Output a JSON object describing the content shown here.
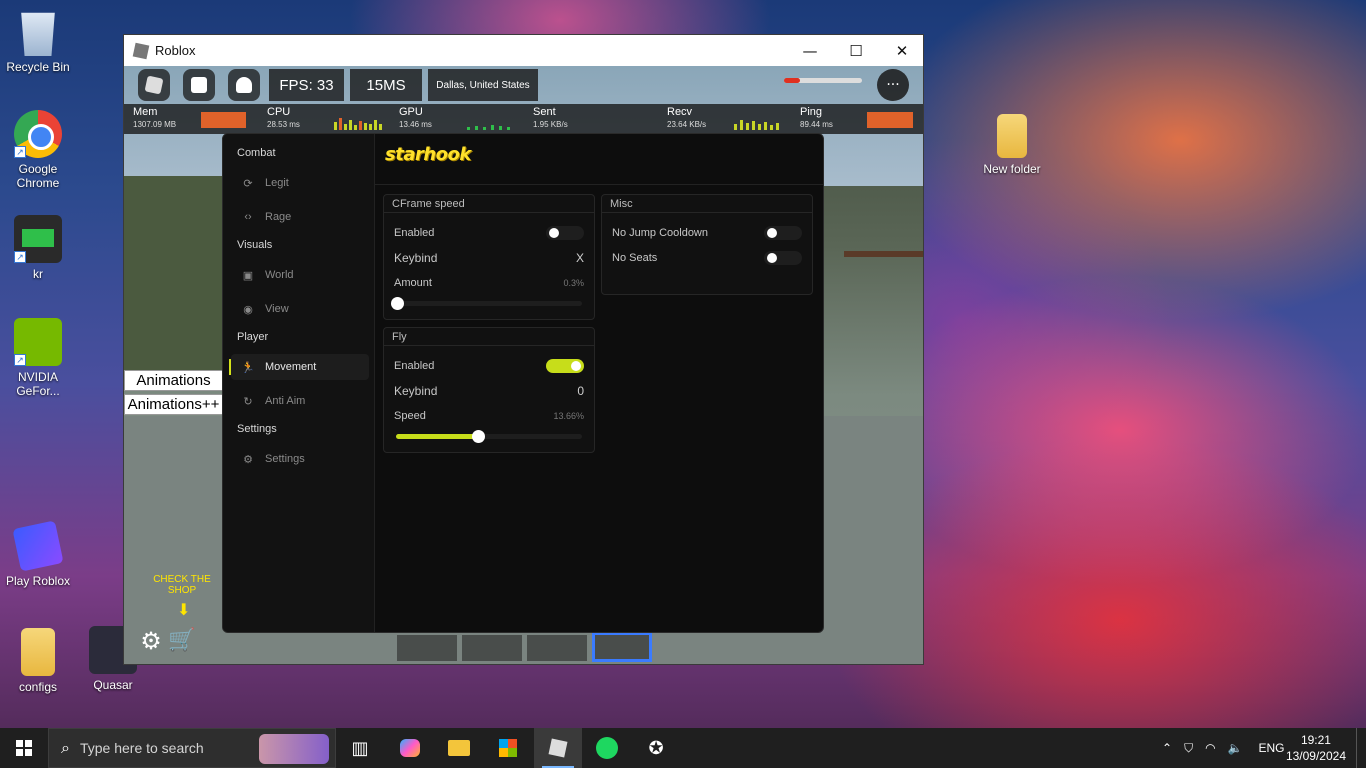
{
  "desktop": {
    "icons": [
      {
        "label": "Recycle Bin",
        "icon": "recycle-bin-icon"
      },
      {
        "label": "Google Chrome",
        "icon": "chrome-icon"
      },
      {
        "label": "kr",
        "icon": "kr-app-icon"
      },
      {
        "label": "NVIDIA GeFor...",
        "icon": "nvidia-icon"
      },
      {
        "label": "Play Roblox",
        "icon": "roblox-icon"
      },
      {
        "label": "configs",
        "icon": "folder-icon"
      },
      {
        "label": "Quasar",
        "icon": "quasar-icon"
      },
      {
        "label": "New folder",
        "icon": "folder-icon"
      }
    ]
  },
  "roblox_window": {
    "title": "Roblox",
    "controls": {
      "minimize": "—",
      "maximize": "☐",
      "close": "✕"
    },
    "topbar": {
      "fps": "FPS: 33",
      "ms": "15MS",
      "location": "Dallas, United States",
      "menu_icon": "···",
      "health": 0.2
    },
    "perf": {
      "mem": {
        "label": "Mem",
        "value": "1307.09 MB"
      },
      "cpu": {
        "label": "CPU",
        "value": "28.53 ms"
      },
      "gpu": {
        "label": "GPU",
        "value": "13.46 ms"
      },
      "sent": {
        "label": "Sent",
        "value": "1.95 KB/s"
      },
      "recv": {
        "label": "Recv",
        "value": "23.64 KB/s"
      },
      "ping": {
        "label": "Ping",
        "value": "89.44 ms"
      }
    },
    "game_labels": {
      "animations": "Animations",
      "animations_plus": "Animations++",
      "shop": "CHECK THE SHOP"
    }
  },
  "starhook": {
    "logo": "starhook",
    "sidebar": {
      "sections": [
        {
          "title": "Combat",
          "items": [
            {
              "label": "Legit",
              "icon": "refresh-icon"
            },
            {
              "label": "Rage",
              "icon": "code-icon"
            }
          ]
        },
        {
          "title": "Visuals",
          "items": [
            {
              "label": "World",
              "icon": "map-icon"
            },
            {
              "label": "View",
              "icon": "eye-icon"
            }
          ]
        },
        {
          "title": "Player",
          "items": [
            {
              "label": "Movement",
              "icon": "running-icon"
            },
            {
              "label": "Anti Aim",
              "icon": "rotate-icon"
            }
          ]
        },
        {
          "title": "Settings",
          "items": [
            {
              "label": "Settings",
              "icon": "gear-icon"
            }
          ]
        }
      ],
      "active": "Movement"
    },
    "cframe": {
      "title": "CFrame speed",
      "enabled_label": "Enabled",
      "enabled": false,
      "keybind_label": "Keybind",
      "keybind": "X",
      "amount_label": "Amount",
      "amount": "0.3%",
      "amount_fraction": 0.003
    },
    "fly": {
      "title": "Fly",
      "enabled_label": "Enabled",
      "enabled": true,
      "keybind_label": "Keybind",
      "keybind": "0",
      "speed_label": "Speed",
      "speed": "13.66%",
      "speed_fraction": 0.44
    },
    "misc": {
      "title": "Misc",
      "no_jump_label": "No Jump Cooldown",
      "no_jump": false,
      "no_seats_label": "No Seats",
      "no_seats": false
    }
  },
  "taskbar": {
    "search_placeholder": "Type here to search",
    "apps": [
      "task-view-icon",
      "copilot-icon",
      "file-explorer-icon",
      "store-icon",
      "roblox-icon",
      "spotify-icon",
      "starhook-icon"
    ],
    "language": "ENG",
    "time": "19:21",
    "date": "13/09/2024"
  }
}
